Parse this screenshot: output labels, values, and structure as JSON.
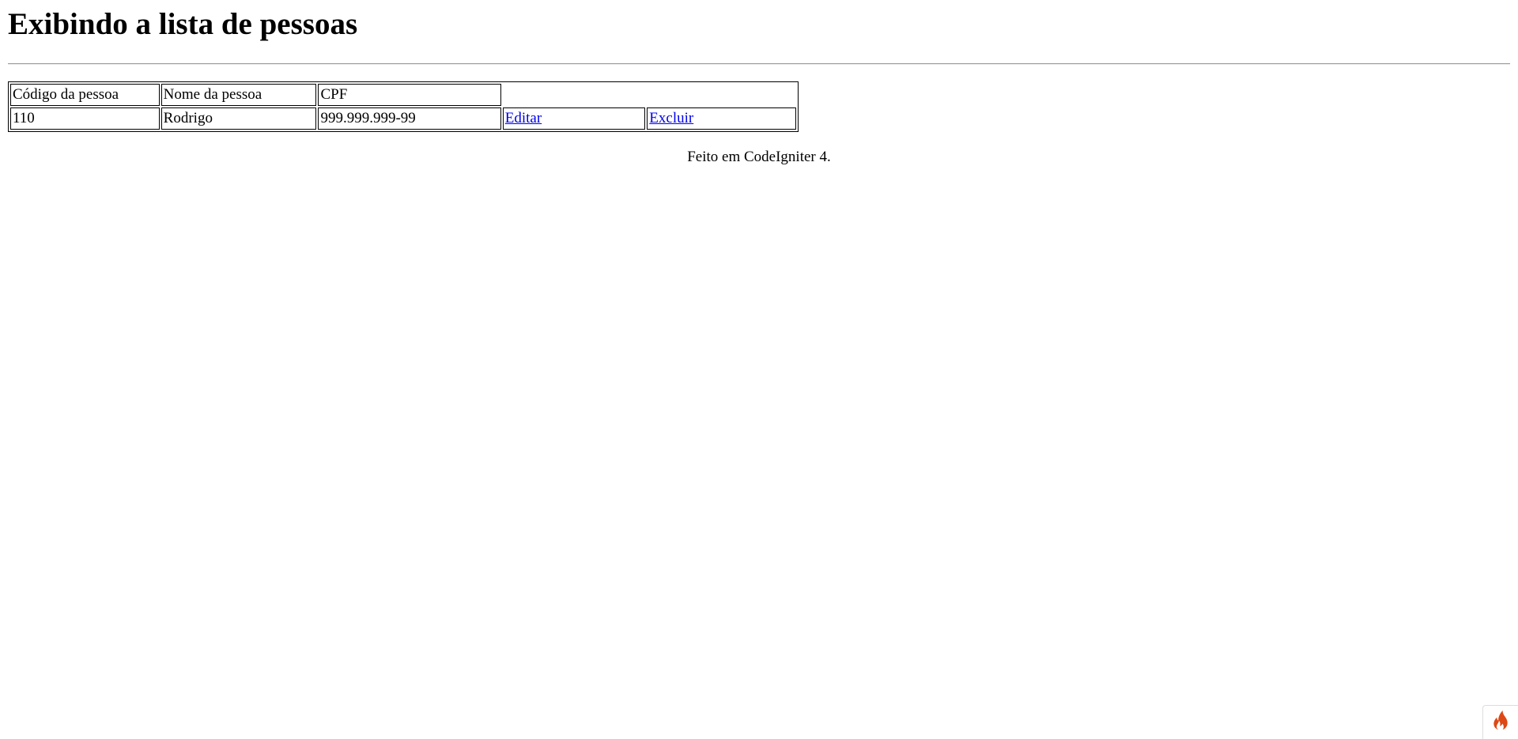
{
  "page": {
    "title": "Exibindo a lista de pessoas"
  },
  "table": {
    "headers": [
      "Código da pessoa",
      "Nome da pessoa",
      "CPF"
    ],
    "rows": [
      {
        "codigo": "110",
        "nome": "Rodrigo",
        "cpf": "999.999.999-99",
        "edit_label": "Editar",
        "delete_label": "Excluir"
      }
    ]
  },
  "footer": {
    "text": "Feito em CodeIgniter 4."
  },
  "debug_toolbar": {
    "icon": "codeigniter-flame-icon",
    "color": "#dd4814"
  }
}
